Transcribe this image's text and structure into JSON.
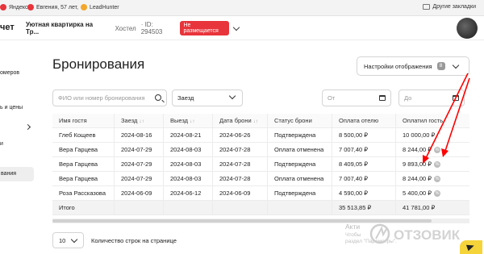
{
  "bookmarks": {
    "items": [
      {
        "label": "Яндекс",
        "icon": "yandex-icon",
        "color": "#e8343b"
      },
      {
        "label": "Евгения, 57 лет, ",
        "icon": "profile-icon",
        "color": "#e8343b"
      },
      {
        "label": "LeadHunter",
        "icon": "leadhunter-icon",
        "color": "#f3a72b"
      }
    ],
    "other": "Другие закладки"
  },
  "header": {
    "logo_fragment": "чет",
    "property_title": "Уютная квартирка на Тр...",
    "hostel_label": "Хостел",
    "hostel_id": "· ID: 294503",
    "status_badge": "Не размещается"
  },
  "sidebar": {
    "items": [
      "омеров",
      "ь и цены",
      "и",
      "вания"
    ],
    "active_index": 3
  },
  "page": {
    "title": "Бронирования",
    "settings_label": "Настройки отображения",
    "settings_badge": "8"
  },
  "filters": {
    "search_placeholder": "ФИО или номер бронирования",
    "date_type": "Заезд",
    "date_from_placeholder": "От",
    "date_to_placeholder": "До"
  },
  "table": {
    "headers": [
      "Имя гостя",
      "Заезд",
      "Выезд",
      "Дата брони",
      "Статус брони",
      "Оплата отелю",
      "Оплатил гость"
    ],
    "rows": [
      [
        "Глеб Кощеев",
        "2024-08-16",
        "2024-08-21",
        "2024-06-26",
        "Подтверждена",
        "8 500,00 ₽",
        "10 000,00 ₽"
      ],
      [
        "Вера Гарцева",
        "2024-07-29",
        "2024-08-03",
        "2024-07-28",
        "Оплата отменена",
        "7 007,40 ₽",
        "8 244,00 ₽"
      ],
      [
        "Вера Гарцева",
        "2024-07-29",
        "2024-08-03",
        "2024-07-28",
        "Подтверждена",
        "8 409,05 ₽",
        "9 893,00 ₽"
      ],
      [
        "Вера Гарцева",
        "2024-07-29",
        "2024-08-03",
        "2024-07-28",
        "Оплата отменена",
        "7 007,40 ₽",
        "8 244,00 ₽"
      ],
      [
        "Роза Рассказова",
        "2024-06-09",
        "2024-06-12",
        "2024-06-09",
        "Подтверждена",
        "4 590,00 ₽",
        "5 400,00 ₽"
      ]
    ],
    "percent_icon_rows": [
      1,
      2,
      3,
      4
    ],
    "total_label": "Итого",
    "total_hotel": "35 513,85 ₽",
    "total_guest": "41 781,00 ₽"
  },
  "pagination": {
    "rows_per_page": "10",
    "label": "Количество строк на странице"
  },
  "watermark": {
    "title": "Акти",
    "line1": "Чтобы",
    "line2": "раздел \"Параметры\"."
  },
  "otzovik": {
    "text": "ОТЗОВИК"
  },
  "colors": {
    "accent_red": "#e8343b",
    "arrow_red": "#ff0000",
    "fab_yellow": "#f5d43a"
  }
}
